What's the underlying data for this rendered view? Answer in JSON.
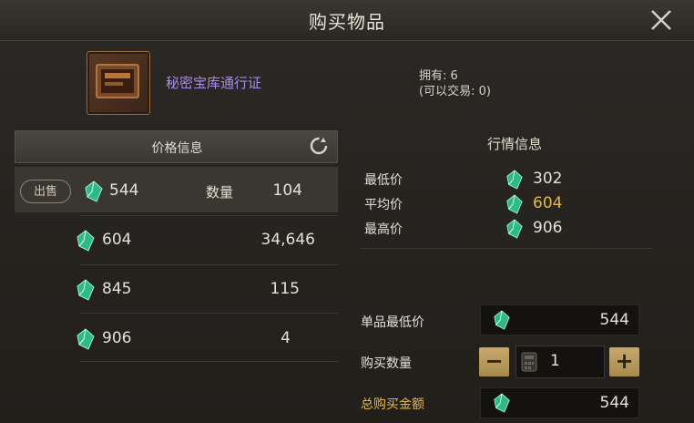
{
  "window": {
    "title": "购买物品"
  },
  "item": {
    "name": "秘密宝库通行证",
    "owned": "拥有: 6",
    "tradable": "(可以交易: 0)"
  },
  "price_panel": {
    "header": "价格信息",
    "sell_button": "出售",
    "quantity_label": "数量",
    "rows": [
      {
        "price": "544",
        "quantity": "104"
      },
      {
        "price": "604",
        "quantity": "34,646"
      },
      {
        "price": "845",
        "quantity": "115"
      },
      {
        "price": "906",
        "quantity": "4"
      }
    ]
  },
  "market_panel": {
    "header": "行情信息",
    "stats": [
      {
        "label": "最低价",
        "value": "302"
      },
      {
        "label": "平均价",
        "value": "604"
      },
      {
        "label": "最高价",
        "value": "906"
      }
    ]
  },
  "purchase": {
    "unit_price_label": "单品最低价",
    "unit_price": "544",
    "quantity_label": "购买数量",
    "quantity": "1",
    "minus": "−",
    "plus": "+",
    "total_label": "总购买金额",
    "total": "544"
  },
  "colors": {
    "accent_gold": "#e8b54a",
    "item_purple": "#a88ce8",
    "gem_green": "#3fd19a"
  },
  "icons": [
    "close-icon",
    "item-icon",
    "refresh-icon",
    "gem-icon",
    "calculator-icon"
  ]
}
